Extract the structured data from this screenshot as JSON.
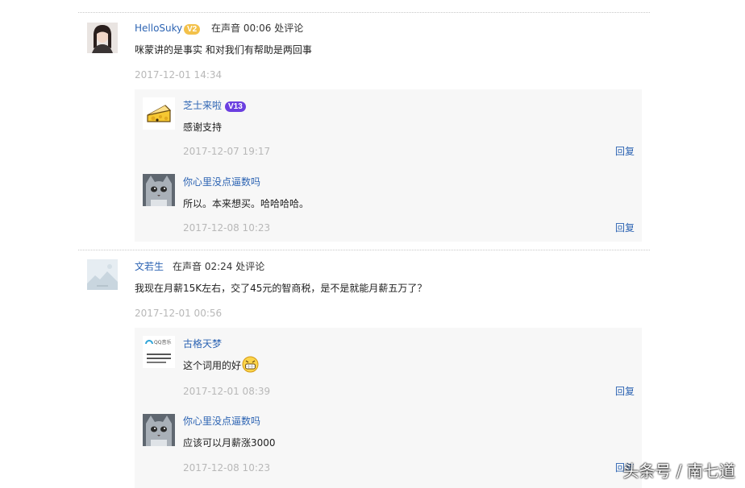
{
  "comments": [
    {
      "user": "HelloSuky",
      "badge": "V2",
      "meta": "在声音 00:06 处评论",
      "text": "咪蒙讲的是事实 和对我们有帮助是两回事",
      "time": "2017-12-01 14:34",
      "replies": [
        {
          "user": "芝士来啦",
          "badge": "V13",
          "text": "感谢支持",
          "time": "2017-12-07 19:17",
          "reply_label": "回复"
        },
        {
          "user": "你心里没点逼数吗",
          "text": "所以。本来想买。哈哈哈哈。",
          "time": "2017-12-08 10:23",
          "reply_label": "回复"
        }
      ]
    },
    {
      "user": "文若生",
      "meta": "在声音 02:24 处评论",
      "text": "我现在月薪15K左右，交了45元的智商税，是不是就能月薪五万了？",
      "time": "2017-12-01 00:56",
      "replies": [
        {
          "user": "古格天梦",
          "text": "这个词用的好",
          "time": "2017-12-01 08:39",
          "reply_label": "回复",
          "avatar_text": "QQ音乐"
        },
        {
          "user": "你心里没点逼数吗",
          "text": "应该可以月薪涨3000",
          "time": "2017-12-08 10:23",
          "reply_label": "回复"
        }
      ]
    }
  ],
  "watermark": "头条号 / 南七道",
  "colors": {
    "link": "#2d64b3",
    "time": "#b8b8b8",
    "reply_bg": "#f7f7f7",
    "badge_v2": "#f3c14a",
    "badge_v13": "#6b3fe0"
  }
}
